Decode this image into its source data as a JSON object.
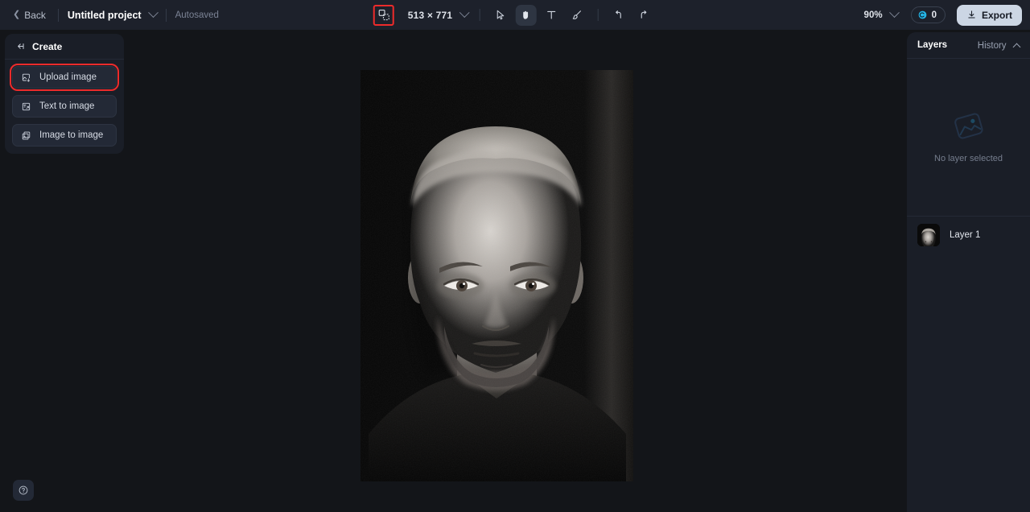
{
  "topbar": {
    "back_label": "Back",
    "project_name": "Untitled project",
    "autosaved_label": "Autosaved",
    "canvas_dimensions": "513 × 771",
    "zoom_level": "90%",
    "credits_count": "0",
    "export_label": "Export",
    "tools": [
      {
        "name": "resize-tool",
        "icon": "resize-icon",
        "active": false,
        "highlighted": true
      },
      {
        "name": "select-tool",
        "icon": "cursor-arrow-icon",
        "active": false
      },
      {
        "name": "hand-tool",
        "icon": "hand-icon",
        "active": true
      },
      {
        "name": "text-tool",
        "icon": "text-icon",
        "active": false
      },
      {
        "name": "brush-tool",
        "icon": "brush-icon",
        "active": false
      },
      {
        "name": "undo-tool",
        "icon": "undo-icon",
        "active": false
      },
      {
        "name": "redo-tool",
        "icon": "redo-icon",
        "active": false
      }
    ]
  },
  "sidebar": {
    "title": "Create",
    "collapse_icon": "collapse-panel-icon",
    "items": [
      {
        "label": "Upload image",
        "icon": "upload-image-icon",
        "highlighted": true
      },
      {
        "label": "Text to image",
        "icon": "text-to-image-icon",
        "highlighted": false
      },
      {
        "label": "Image to image",
        "icon": "image-to-image-icon",
        "highlighted": false
      }
    ],
    "help_icon": "help-circle-icon"
  },
  "right_panel": {
    "tab_layers": "Layers",
    "tab_history": "History",
    "empty_state_text": "No layer selected",
    "empty_state_icon": "image-placeholder-icon",
    "layers": [
      {
        "name": "Layer 1"
      }
    ]
  },
  "colors": {
    "accent_highlight": "#ee2b2b",
    "credit_icon": "#25b6e8",
    "export_bg": "#ccd6e4",
    "topbar_bg": "#1d212b",
    "panel_bg": "#1a1e27",
    "canvas_bg": "#131519"
  }
}
